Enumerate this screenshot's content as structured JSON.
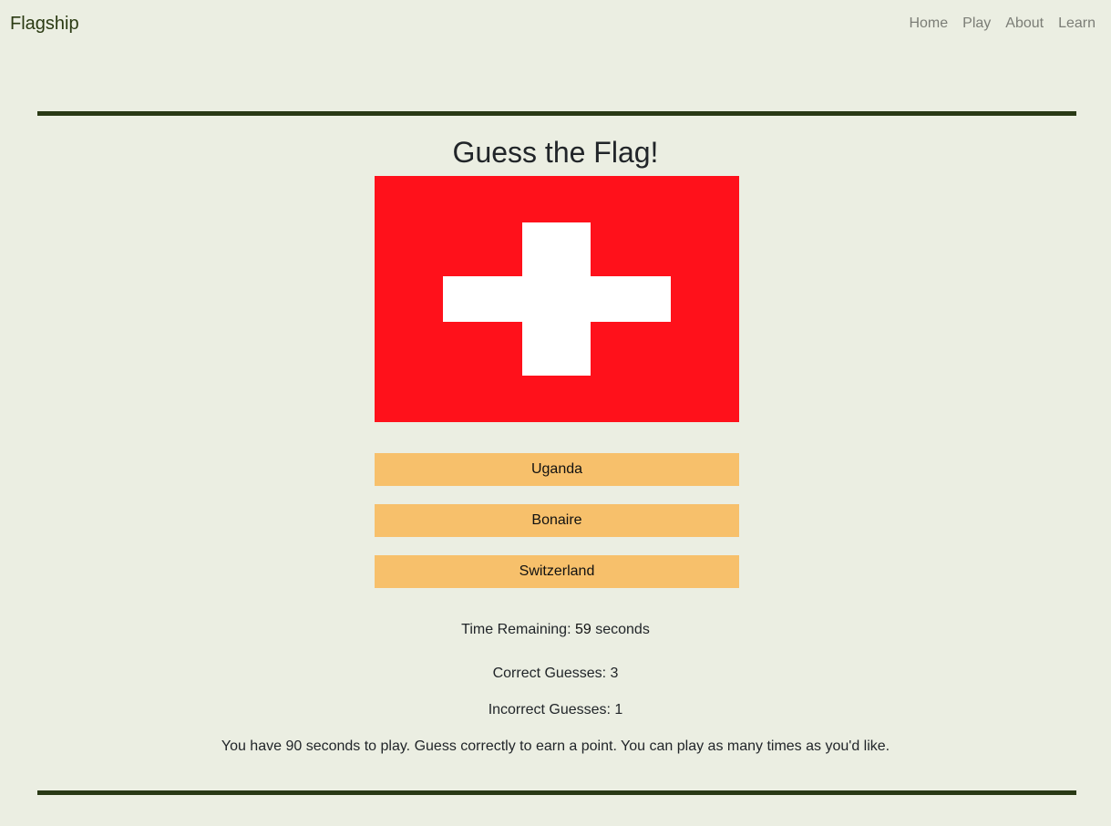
{
  "nav": {
    "brand": "Flagship",
    "links": [
      "Home",
      "Play",
      "About",
      "Learn"
    ]
  },
  "game": {
    "title": "Guess the Flag!",
    "flag_icon": "switzerland-flag",
    "flag_colors": {
      "field": "#ff111b",
      "cross": "#ffffff"
    },
    "answers": [
      "Uganda",
      "Bonaire",
      "Switzerland"
    ],
    "timer_prefix": "Time Remaining:",
    "timer_value": "59",
    "timer_suffix": "seconds",
    "correct_label": "Correct Guesses: 3",
    "incorrect_label": "Incorrect Guesses: 1",
    "rules": "You have 90 seconds to play. Guess correctly to earn a point. You can play as many times as you'd like."
  },
  "colors": {
    "background": "#ebeee2",
    "accent_rule": "#293915",
    "answer_button": "#f7c06b"
  }
}
